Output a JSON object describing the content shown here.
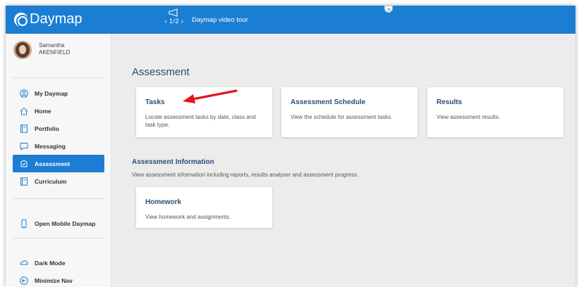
{
  "app": {
    "logo_text": "Daymap",
    "tour": {
      "pager": "‹ 1/2 ›",
      "title": "Daymap video tour"
    }
  },
  "user": {
    "first_name": "Samantha",
    "last_name": "AKENFIELD"
  },
  "sidebar": {
    "items": [
      {
        "label": "My Daymap",
        "icon": "person-circle-icon"
      },
      {
        "label": "Home",
        "icon": "home-icon"
      },
      {
        "label": "Portfolio",
        "icon": "portfolio-icon"
      },
      {
        "label": "Messaging",
        "icon": "chat-icon"
      },
      {
        "label": "Assessment",
        "icon": "assessment-icon",
        "active": true
      },
      {
        "label": "Curriculum",
        "icon": "curriculum-icon"
      }
    ],
    "open_mobile": "Open Mobile Daymap",
    "dark_mode": "Dark Mode",
    "minimize_nav": "Minimize Nav"
  },
  "main": {
    "heading": "Assessment",
    "cards": [
      {
        "title": "Tasks",
        "desc": "Locate assessment tasks by date, class and task type."
      },
      {
        "title": "Assessment Schedule",
        "desc": "View the schedule for assessment tasks."
      },
      {
        "title": "Results",
        "desc": "View assessment results."
      }
    ],
    "section": {
      "title": "Assessment Information",
      "desc": "View assessment information including reports, results analyser and assessment progress."
    },
    "homework": {
      "title": "Homework",
      "desc": "View homework and assignments."
    }
  },
  "colors": {
    "brand_blue": "#1b7ed3",
    "heading_navy": "#2a4d75",
    "annotation_red": "#e0161b"
  }
}
